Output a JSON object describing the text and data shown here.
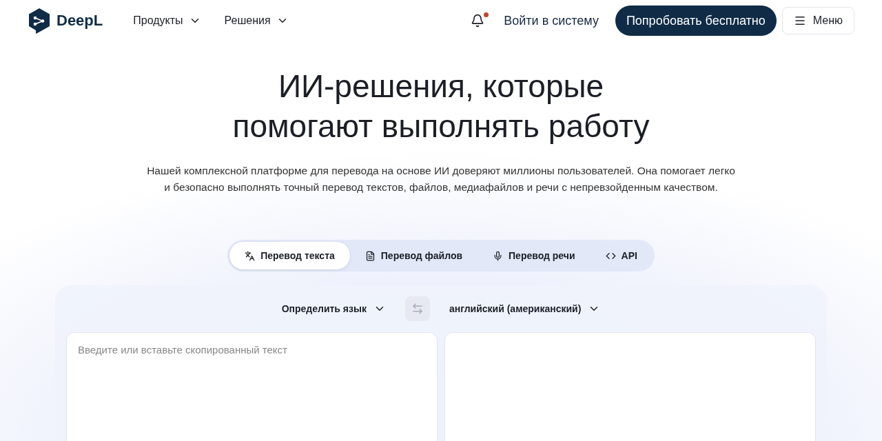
{
  "header": {
    "logo": "DeepL",
    "nav": [
      {
        "label": "Продукты"
      },
      {
        "label": "Решения"
      }
    ],
    "notification": true,
    "login": "Войти в систему",
    "cta": "Попробовать бесплатно",
    "menu": "Меню"
  },
  "hero": {
    "title_lines": [
      "ИИ-решения, которые",
      "помогают выполнять работу"
    ],
    "subtitle_lines": [
      "Нашей комплексной платформе для перевода на основе ИИ доверяют миллионы пользователей. Она помогает легко",
      "и безопасно выполнять точный перевод текстов, файлов, медиафайлов и речи с непревзойденным качеством."
    ]
  },
  "tabs": [
    {
      "label": "Перевод текста",
      "kind": "text",
      "selected": true
    },
    {
      "label": "Перевод файлов",
      "kind": "file",
      "selected": false
    },
    {
      "label": "Перевод речи",
      "kind": "voice",
      "selected": false
    },
    {
      "label": "API",
      "kind": "api",
      "selected": false
    }
  ],
  "translator": {
    "source_language": "Определить язык",
    "target_language": "английский (американский)",
    "source_placeholder": "Введите или вставьте скопированный текст"
  }
}
